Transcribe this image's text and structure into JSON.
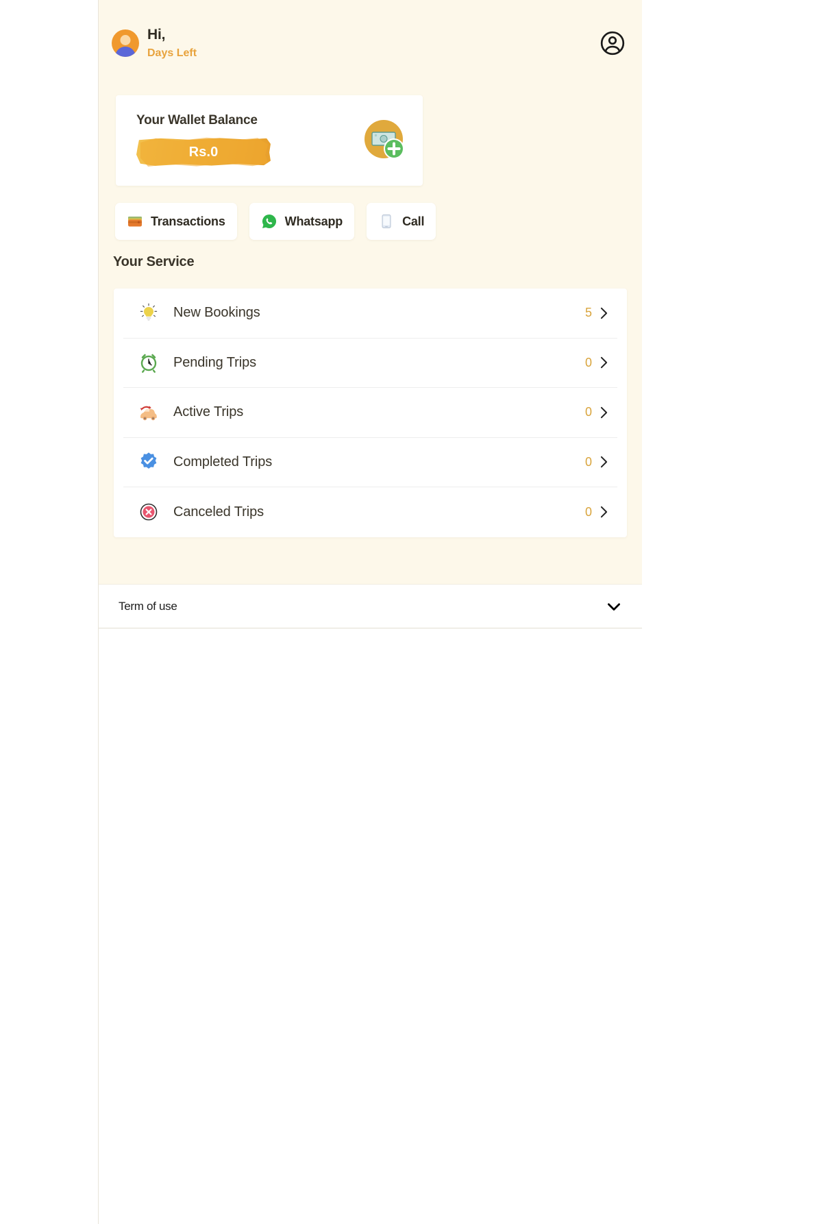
{
  "header": {
    "greeting": "Hi,",
    "days_left": "Days Left",
    "avatar_icon": "user-avatar",
    "account_icon": "account-circle-icon"
  },
  "wallet": {
    "title": "Your Wallet Balance",
    "amount": "Rs.0",
    "icon": "add-money-icon",
    "accent_color": "#eeb13c"
  },
  "actions": [
    {
      "label": "Transactions",
      "icon": "wallet-icon"
    },
    {
      "label": "Whatsapp",
      "icon": "whatsapp-icon"
    },
    {
      "label": "Call",
      "icon": "mobile-phone-icon"
    }
  ],
  "service": {
    "heading": "Your Service",
    "items": [
      {
        "label": "New Bookings",
        "count": "5",
        "icon": "lightbulb-icon"
      },
      {
        "label": "Pending Trips",
        "count": "0",
        "icon": "alarm-clock-icon"
      },
      {
        "label": "Active Trips",
        "count": "0",
        "icon": "car-icon"
      },
      {
        "label": "Completed Trips",
        "count": "0",
        "icon": "verified-check-icon"
      },
      {
        "label": "Canceled Trips",
        "count": "0",
        "icon": "cancel-circle-icon"
      }
    ],
    "count_color": "#d9a43c"
  },
  "footer": {
    "terms_label": "Term of use",
    "expand_icon": "chevron-down-icon"
  }
}
